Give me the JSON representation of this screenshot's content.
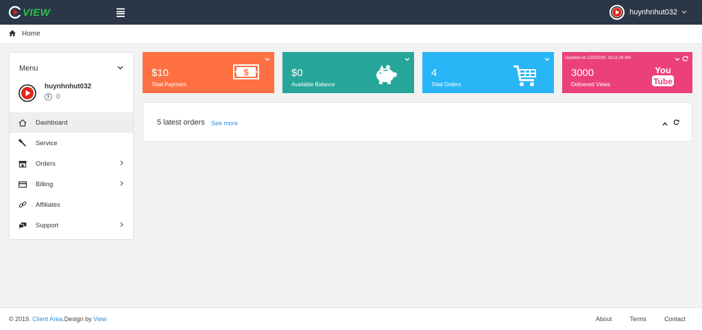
{
  "brand": {
    "name": "VIEW",
    "accent": "#2dc34a",
    "logo_red": "#e0261b"
  },
  "topbar": {
    "username": "huynhnhut032",
    "bg": "#2b3647"
  },
  "breadcrumb": {
    "home_label": "Home"
  },
  "sidebar": {
    "title": "Menu",
    "username": "huynhnhut032",
    "balance": "0",
    "items": [
      {
        "label": "Dashboard",
        "icon": "home-icon",
        "active": true,
        "has_arrow": false
      },
      {
        "label": "Service",
        "icon": "wrench-icon",
        "active": false,
        "has_arrow": false
      },
      {
        "label": "Orders",
        "icon": "store-icon",
        "active": false,
        "has_arrow": true
      },
      {
        "label": "Billing",
        "icon": "credit-card-icon",
        "active": false,
        "has_arrow": true
      },
      {
        "label": "Affiliates",
        "icon": "link-icon",
        "active": false,
        "has_arrow": false
      },
      {
        "label": "Support",
        "icon": "chat-icon",
        "active": false,
        "has_arrow": true
      }
    ]
  },
  "cards": [
    {
      "value": "$10",
      "label": "Total Payment",
      "icon": "money-bill-icon",
      "color": "#ff7043"
    },
    {
      "value": "$0",
      "label": "Available Balance",
      "icon": "piggy-bank-icon",
      "color": "#26a69a"
    },
    {
      "value": "4",
      "label": "Total Orders",
      "icon": "shopping-cart-icon",
      "color": "#29b6f6"
    },
    {
      "value": "3000",
      "label": "Delivered Views",
      "icon": "youtube-icon",
      "color": "#ec407a",
      "updated": "Updated on 12/2/2019, 10:11:24 AM"
    }
  ],
  "orders_panel": {
    "title": "5 latest orders",
    "see_more": "See more"
  },
  "footer": {
    "copyright": "© 2019.",
    "client_area": "Client Area",
    "design_by": ".Design by",
    "designer": "View",
    "links": [
      "About",
      "Terms",
      "Contact"
    ]
  }
}
